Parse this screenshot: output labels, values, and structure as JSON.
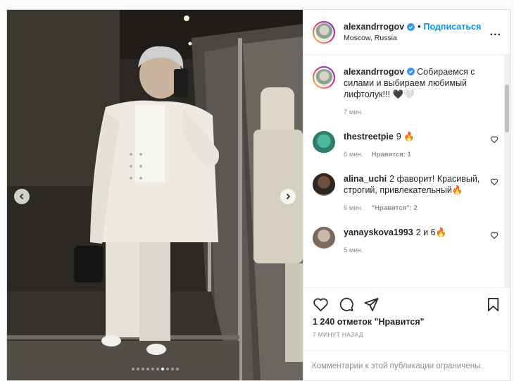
{
  "post": {
    "author": {
      "username": "alexandrrogov",
      "follow_label": "Подписаться",
      "separator": "•",
      "location": "Moscow, Russia",
      "more_label": "..."
    },
    "photo": {
      "slide_count": 10,
      "active_slide": 7
    },
    "caption": {
      "username": "alexandrrogov",
      "text": "Собираемся с силами и выбираем любимый лифтолук!!! 🖤🤍",
      "time": "7 мин."
    },
    "comments": [
      {
        "username": "thestreetpie",
        "text": "9 🔥",
        "time": "6 мин.",
        "likes_label": "Нравится: 1"
      },
      {
        "username": "alina_uchi",
        "text": "2 фаворит! Красивый, строгий, привлекательный🔥",
        "time": "6 мин.",
        "likes_label": "\"Нравится\": 2"
      },
      {
        "username": "yanayskova1993",
        "text": "2 и 6🔥",
        "time": "5 мин.",
        "likes_label": ""
      }
    ],
    "likes_text": "1 240 отметок \"Нравится\"",
    "posted_ago": "7 МИНУТ НАЗАД",
    "comments_disabled": "Комментарии к этой публикации ограничены."
  },
  "colors": {
    "accent": "#0095f6",
    "secondary_text": "#8e8e8e",
    "fire": "#f5a623"
  }
}
